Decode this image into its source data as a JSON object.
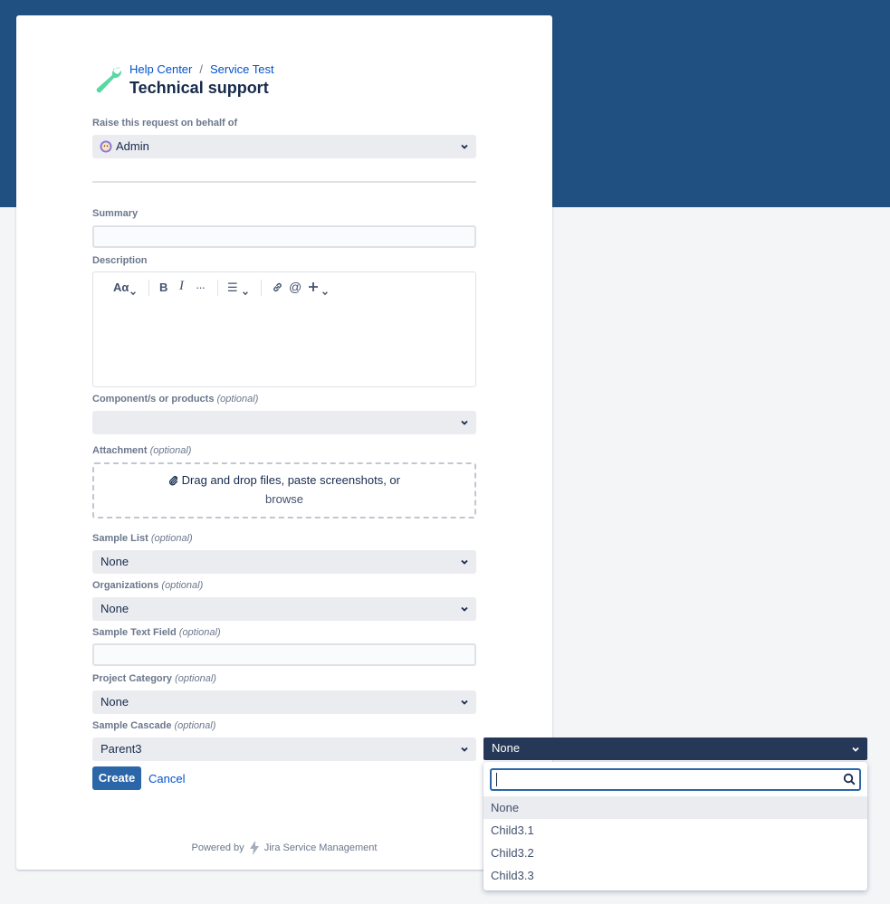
{
  "breadcrumb": {
    "help_center": "Help Center",
    "separator": "/",
    "service": "Service Test"
  },
  "page_title": "Technical support",
  "on_behalf": {
    "label": "Raise this request on behalf of",
    "value": "Admin"
  },
  "summary": {
    "label": "Summary",
    "value": ""
  },
  "description": {
    "label": "Description",
    "toolbar": {
      "text_style": "Aα",
      "bold": "B",
      "italic": "I",
      "more": "···",
      "list": "☰"
    }
  },
  "components": {
    "label": "Component/s or products",
    "optional": "(optional)",
    "value": ""
  },
  "attachment": {
    "label": "Attachment",
    "optional": "(optional)",
    "line1": "Drag and drop files, paste screenshots, or",
    "line2": "browse"
  },
  "sample_list": {
    "label": "Sample List",
    "optional": "(optional)",
    "value": "None"
  },
  "organizations": {
    "label": "Organizations",
    "optional": "(optional)",
    "value": "None"
  },
  "sample_text": {
    "label": "Sample Text Field",
    "optional": "(optional)",
    "value": ""
  },
  "project_category": {
    "label": "Project Category",
    "optional": "(optional)",
    "value": "None"
  },
  "sample_cascade": {
    "label": "Sample Cascade",
    "optional": "(optional)",
    "parent_value": "Parent3",
    "child_value": "None",
    "search_value": "",
    "options": [
      "None",
      "Child3.1",
      "Child3.2",
      "Child3.3"
    ],
    "selected_option": "None"
  },
  "actions": {
    "create": "Create",
    "cancel": "Cancel"
  },
  "footer": {
    "powered_by": "Powered by",
    "product": "Jira Service Management"
  },
  "colors": {
    "banner": "#205081",
    "primary_button": "#2a66a8",
    "link": "#0052cc",
    "cascade_select": "#253858",
    "wrench": "#57d9a3"
  }
}
